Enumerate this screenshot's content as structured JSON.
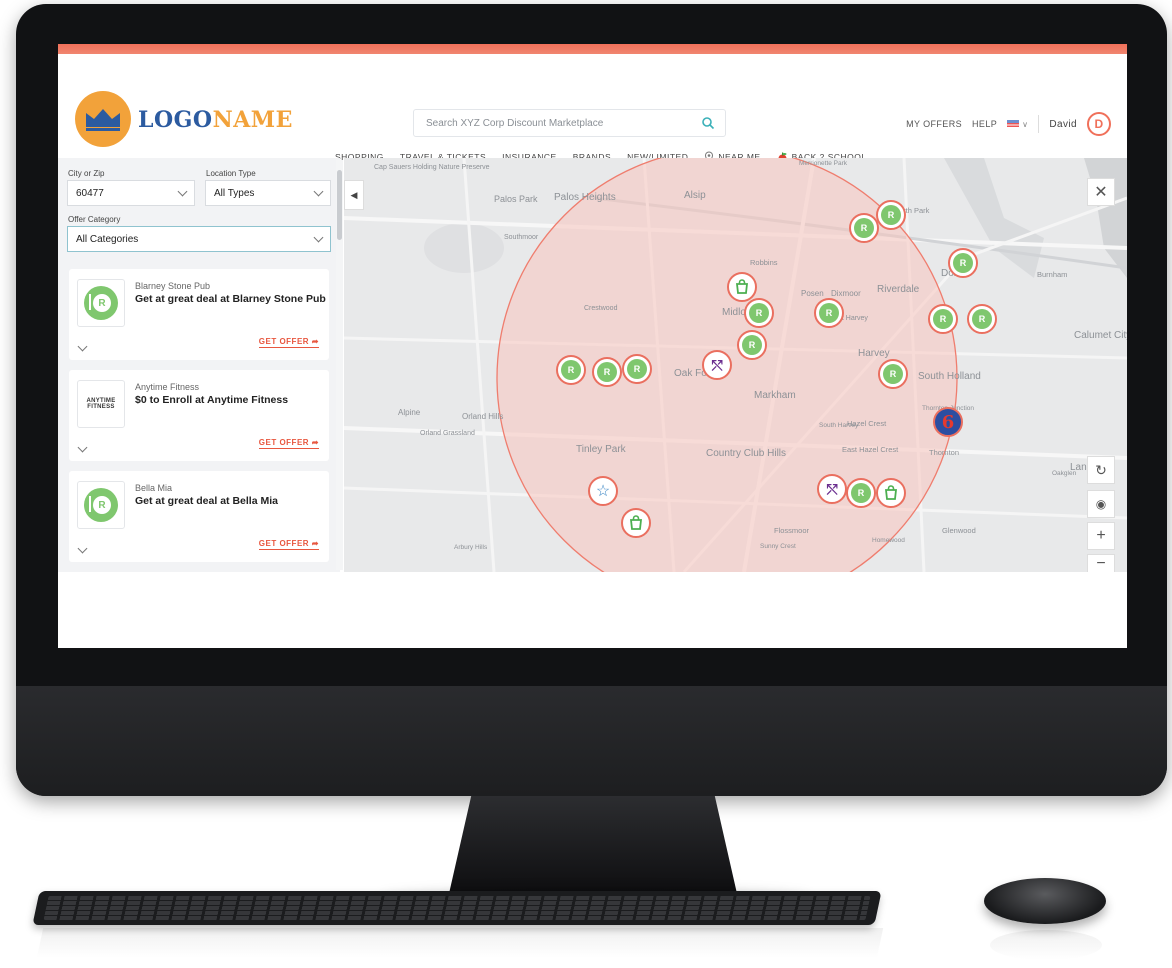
{
  "brand": {
    "logo_part1": "LOGO",
    "logo_part2": "NAME",
    "primary_color": "#2c5ba0",
    "accent_color": "#f0705a",
    "logo_color": "#f2a23a"
  },
  "search": {
    "placeholder": "Search XYZ Corp Discount Marketplace"
  },
  "topnav": {
    "my_offers": "MY OFFERS",
    "help": "HELP",
    "user_name": "David",
    "avatar_initial": "D"
  },
  "mainnav": {
    "items": [
      "SHOPPING",
      "TRAVEL & TICKETS",
      "INSURANCE",
      "BRANDS",
      "NEW/LIMITED",
      "NEAR ME",
      "BACK 2 SCHOOL"
    ]
  },
  "filters": {
    "city_label": "City or Zip",
    "city_value": "60477",
    "location_type_label": "Location Type",
    "location_type_value": "All Types",
    "category_label": "Offer Category",
    "category_value": "All Categories"
  },
  "offers": [
    {
      "merchant": "Blarney Stone Pub",
      "offer": "Get at great deal at Blarney Stone Pub",
      "cta": "GET OFFER",
      "logo": "restaurant-icon"
    },
    {
      "merchant": "Anytime Fitness",
      "offer": "$0 to Enroll at Anytime Fitness",
      "cta": "GET OFFER",
      "logo": "anytime-fitness-logo"
    },
    {
      "merchant": "Bella Mia",
      "offer": "Get at great deal at Bella Mia",
      "cta": "GET OFFER",
      "logo": "restaurant-icon"
    }
  ],
  "anytime_logo_text": "ANYTIME FITNESS",
  "map": {
    "labels": [
      "Cap Sauers Holding Nature Preserve",
      "Palos Park",
      "Palos Heights",
      "Alsip",
      "Southmoor",
      "Robbins",
      "Posen",
      "Dixmoor",
      "Riverdale",
      "Dolton",
      "Burnham",
      "Midlothian",
      "Crestwood",
      "West Harvey",
      "Harvey",
      "Calumet City",
      "Oak Forest",
      "Markham",
      "South Holland",
      "Alpine",
      "Orland Hills",
      "Orland Grassland",
      "Tinley Park",
      "Country Club Hills",
      "Hazel Crest",
      "East Hazel Crest",
      "Thornton",
      "South Harvey",
      "Thornton Junction",
      "Flossmoor",
      "Sunny Crest",
      "Homewood",
      "Glenwood",
      "Lansing",
      "Arbury Hills",
      "Oakglen",
      "Merrionette Park",
      "Worth Park"
    ],
    "radius_color": "#f7c4bd"
  }
}
